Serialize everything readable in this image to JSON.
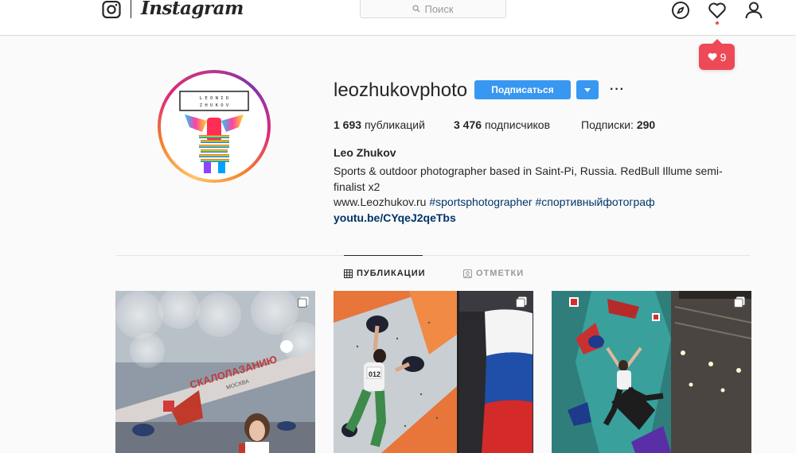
{
  "header": {
    "brand": "Instagram",
    "search_placeholder": "Поиск",
    "notification_count": "9"
  },
  "profile": {
    "username": "leozhukovphoto",
    "follow_label": "Подписаться",
    "more_label": "···",
    "avatar_text_line1": "L E O N I D",
    "avatar_text_line2": "Z H U K O V",
    "stats": {
      "posts_value": "1 693",
      "posts_label": "публикаций",
      "followers_value": "3 476",
      "followers_label": "подписчиков",
      "following_label": "Подписки:",
      "following_value": "290"
    },
    "full_name": "Leo Zhukov",
    "bio": "Sports & outdoor photographer based in Saint-Pi, Russia. RedBull Illume semi-finalist x2",
    "website_text": "www.Leozhukov.ru",
    "hashtag1": "#sportsphotographer",
    "hashtag2": "#спортивныйфотограф",
    "link": "youtu.be/CYqeJ2qeTbs"
  },
  "tabs": [
    {
      "label": "ПУБЛИКАЦИИ",
      "active": true
    },
    {
      "label": "ОТМЕТКИ",
      "active": false
    }
  ],
  "posts": {
    "post1_banner": "СКАЛОЛАЗАНИЮ",
    "post1_banner2": "МОСКВА",
    "post2_bib": "012"
  },
  "colors": {
    "accent": "#3897f0",
    "notification": "#ed4956",
    "link": "#003569"
  }
}
